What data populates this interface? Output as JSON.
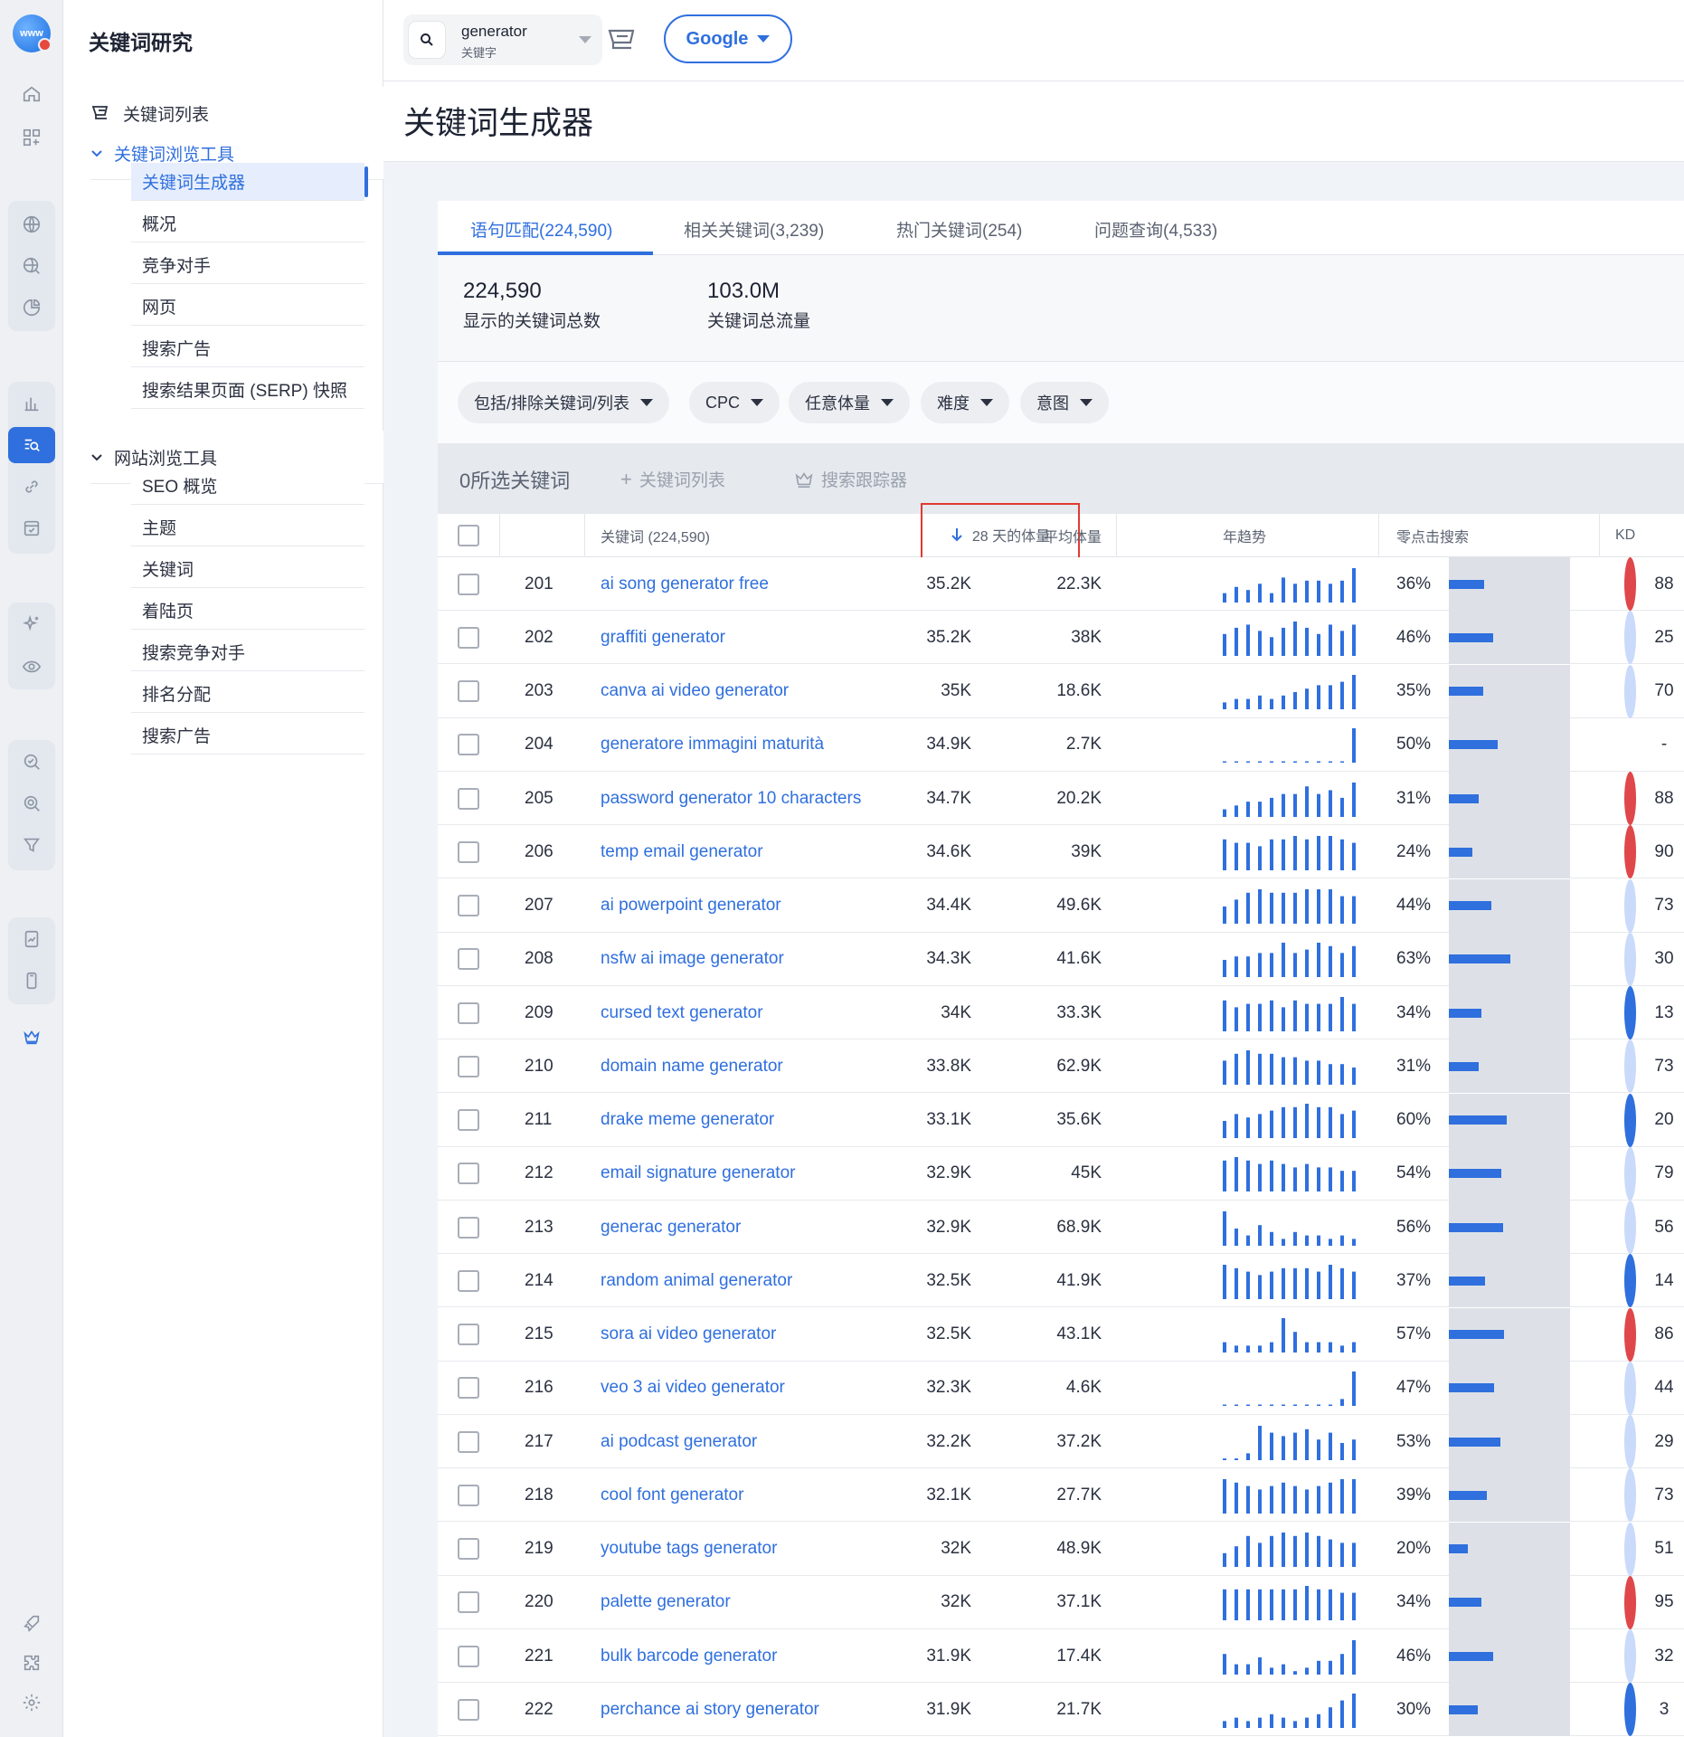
{
  "sidebar": {
    "title": "关键词研究",
    "keyword_list": "关键词列表",
    "keyword_explorer": "关键词浏览工具",
    "keyword_explorer_items": [
      "关键词生成器",
      "概况",
      "竞争对手",
      "网页",
      "搜索广告",
      "搜索结果页面 (SERP) 快照"
    ],
    "site_explorer": "网站浏览工具",
    "site_explorer_items": [
      "SEO 概览",
      "主题",
      "关键词",
      "着陆页",
      "搜索竞争对手",
      "排名分配",
      "搜索广告"
    ]
  },
  "topbar": {
    "search_value": "generator",
    "search_placeholder": "关键字",
    "engine": "Google"
  },
  "page_title": "关键词生成器",
  "tabs": [
    "语句匹配(224,590)",
    "相关关键词(3,239)",
    "热门关键词(254)",
    "问题查询(4,533)"
  ],
  "stats": {
    "total_keywords": "224,590",
    "total_keywords_label": "显示的关键词总数",
    "total_traffic": "103.0M",
    "total_traffic_label": "关键词总流量"
  },
  "filters": [
    "包括/排除关键词/列表",
    "CPC",
    "任意体量",
    "难度",
    "意图"
  ],
  "selection": {
    "count": "0所选关键词",
    "add_list": "关键词列表",
    "tracker": "搜索跟踪器"
  },
  "table": {
    "headers": {
      "keyword": "关键词 (224,590)",
      "volume_28d": "28 天的体量",
      "avg_volume": "平均体量",
      "trend": "年趋势",
      "zero_click": "零点击搜索",
      "kd": "KD"
    },
    "rows": [
      {
        "n": "201",
        "kw": "ai song generator free",
        "v28": "35.2K",
        "avg": "22.3K",
        "zc": "36%",
        "zcv": 36,
        "kd": "88",
        "kdc": "#e0474a",
        "trend": [
          3,
          5,
          4,
          6,
          3,
          8,
          6,
          7,
          7,
          6,
          7,
          11
        ]
      },
      {
        "n": "202",
        "kw": "graffiti generator",
        "v28": "35.2K",
        "avg": "38K",
        "zc": "46%",
        "zcv": 46,
        "kd": "25",
        "kdc": "#c9dafb",
        "trend": [
          7,
          9,
          10,
          8,
          6,
          9,
          11,
          9,
          7,
          10,
          8,
          10
        ]
      },
      {
        "n": "203",
        "kw": "canva ai video generator",
        "v28": "35K",
        "avg": "18.6K",
        "zc": "35%",
        "zcv": 35,
        "kd": "70",
        "kdc": "#c9dafb",
        "trend": [
          2,
          3,
          3,
          4,
          3,
          4,
          5,
          6,
          7,
          7,
          8,
          10
        ]
      },
      {
        "n": "204",
        "kw": "generatore immagini maturità",
        "v28": "34.9K",
        "avg": "2.7K",
        "zc": "50%",
        "zcv": 50,
        "kd": "-",
        "kdc": "",
        "trend": [
          0.3,
          0.3,
          0.3,
          0.3,
          0.3,
          0.3,
          0.3,
          0.3,
          0.3,
          0.3,
          0.3,
          10
        ]
      },
      {
        "n": "205",
        "kw": "password generator 10 characters",
        "v28": "34.7K",
        "avg": "20.2K",
        "zc": "31%",
        "zcv": 31,
        "kd": "88",
        "kdc": "#e0474a",
        "trend": [
          2,
          3,
          4,
          4,
          5,
          6,
          6,
          8,
          6,
          7,
          5,
          9
        ]
      },
      {
        "n": "206",
        "kw": "temp email generator",
        "v28": "34.6K",
        "avg": "39K",
        "zc": "24%",
        "zcv": 24,
        "kd": "90",
        "kdc": "#e0474a",
        "trend": [
          9,
          8,
          8,
          7,
          9,
          9,
          10,
          9,
          10,
          10,
          9,
          8
        ]
      },
      {
        "n": "207",
        "kw": "ai powerpoint generator",
        "v28": "34.4K",
        "avg": "49.6K",
        "zc": "44%",
        "zcv": 44,
        "kd": "73",
        "kdc": "#c9dafb",
        "trend": [
          5,
          7,
          9,
          10,
          9,
          9,
          9,
          10,
          10,
          10,
          8,
          8
        ]
      },
      {
        "n": "208",
        "kw": "nsfw ai image generator",
        "v28": "34.3K",
        "avg": "41.6K",
        "zc": "63%",
        "zcv": 63,
        "kd": "30",
        "kdc": "#c9dafb",
        "trend": [
          5,
          6,
          6,
          7,
          7,
          10,
          7,
          8,
          10,
          9,
          7,
          9
        ]
      },
      {
        "n": "209",
        "kw": "cursed text generator",
        "v28": "34K",
        "avg": "33.3K",
        "zc": "34%",
        "zcv": 34,
        "kd": "13",
        "kdc": "#2f6fde",
        "trend": [
          9,
          7,
          8,
          8,
          9,
          7,
          9,
          8,
          8,
          8,
          10,
          8
        ]
      },
      {
        "n": "210",
        "kw": "domain name generator",
        "v28": "33.8K",
        "avg": "62.9K",
        "zc": "31%",
        "zcv": 31,
        "kd": "73",
        "kdc": "#c9dafb",
        "trend": [
          7,
          9,
          10,
          9,
          9,
          8,
          8,
          7,
          7,
          6,
          6,
          5
        ]
      },
      {
        "n": "211",
        "kw": "drake meme generator",
        "v28": "33.1K",
        "avg": "35.6K",
        "zc": "60%",
        "zcv": 60,
        "kd": "20",
        "kdc": "#2f6fde",
        "trend": [
          5,
          7,
          6,
          7,
          8,
          9,
          9,
          10,
          9,
          9,
          7,
          8
        ]
      },
      {
        "n": "212",
        "kw": "email signature generator",
        "v28": "32.9K",
        "avg": "45K",
        "zc": "54%",
        "zcv": 54,
        "kd": "79",
        "kdc": "#c9dafb",
        "trend": [
          9,
          10,
          9,
          8,
          9,
          8,
          7,
          8,
          7,
          7,
          6,
          6
        ]
      },
      {
        "n": "213",
        "kw": "generac generator",
        "v28": "32.9K",
        "avg": "68.9K",
        "zc": "56%",
        "zcv": 56,
        "kd": "56",
        "kdc": "#c9dafb",
        "trend": [
          10,
          5,
          3,
          6,
          4,
          2,
          4,
          3,
          3,
          2,
          3,
          2
        ]
      },
      {
        "n": "214",
        "kw": "random animal generator",
        "v28": "32.5K",
        "avg": "41.9K",
        "zc": "37%",
        "zcv": 37,
        "kd": "14",
        "kdc": "#2f6fde",
        "trend": [
          10,
          9,
          8,
          7,
          8,
          9,
          9,
          9,
          8,
          10,
          9,
          8
        ]
      },
      {
        "n": "215",
        "kw": "sora ai video generator",
        "v28": "32.5K",
        "avg": "43.1K",
        "zc": "57%",
        "zcv": 57,
        "kd": "86",
        "kdc": "#e0474a",
        "trend": [
          3,
          2,
          2,
          2,
          3,
          10,
          6,
          3,
          3,
          3,
          2,
          3
        ]
      },
      {
        "n": "216",
        "kw": "veo 3 ai video generator",
        "v28": "32.3K",
        "avg": "4.6K",
        "zc": "47%",
        "zcv": 47,
        "kd": "44",
        "kdc": "#c9dafb",
        "trend": [
          0.3,
          0.3,
          0.3,
          0.3,
          0.3,
          0.3,
          0.3,
          0.3,
          0.3,
          0.3,
          2,
          10
        ]
      },
      {
        "n": "217",
        "kw": "ai podcast generator",
        "v28": "32.2K",
        "avg": "37.2K",
        "zc": "53%",
        "zcv": 53,
        "kd": "29",
        "kdc": "#c9dafb",
        "trend": [
          0.5,
          0.5,
          2,
          10,
          8,
          7,
          8,
          9,
          6,
          8,
          5,
          6
        ]
      },
      {
        "n": "218",
        "kw": "cool font generator",
        "v28": "32.1K",
        "avg": "27.7K",
        "zc": "39%",
        "zcv": 39,
        "kd": "73",
        "kdc": "#c9dafb",
        "trend": [
          10,
          9,
          8,
          7,
          8,
          9,
          8,
          7,
          8,
          9,
          10,
          10
        ]
      },
      {
        "n": "219",
        "kw": "youtube tags generator",
        "v28": "32K",
        "avg": "48.9K",
        "zc": "20%",
        "zcv": 20,
        "kd": "51",
        "kdc": "#c9dafb",
        "trend": [
          4,
          6,
          9,
          7,
          9,
          10,
          9,
          10,
          9,
          8,
          7,
          7
        ]
      },
      {
        "n": "220",
        "kw": "palette generator",
        "v28": "32K",
        "avg": "37.1K",
        "zc": "34%",
        "zcv": 34,
        "kd": "95",
        "kdc": "#e0474a",
        "trend": [
          9,
          9,
          9,
          9,
          9,
          9,
          9,
          10,
          9,
          9,
          8,
          8
        ]
      },
      {
        "n": "221",
        "kw": "bulk barcode generator",
        "v28": "31.9K",
        "avg": "17.4K",
        "zc": "46%",
        "zcv": 46,
        "kd": "32",
        "kdc": "#c9dafb",
        "trend": [
          6,
          3,
          3,
          5,
          2,
          3,
          1,
          2,
          4,
          4,
          6,
          10
        ]
      },
      {
        "n": "222",
        "kw": "perchance ai story generator",
        "v28": "31.9K",
        "avg": "21.7K",
        "zc": "30%",
        "zcv": 30,
        "kd": "3",
        "kdc": "#2f6fde",
        "trend": [
          2,
          3,
          2,
          3,
          4,
          3,
          2,
          3,
          4,
          6,
          8,
          10
        ]
      }
    ]
  }
}
